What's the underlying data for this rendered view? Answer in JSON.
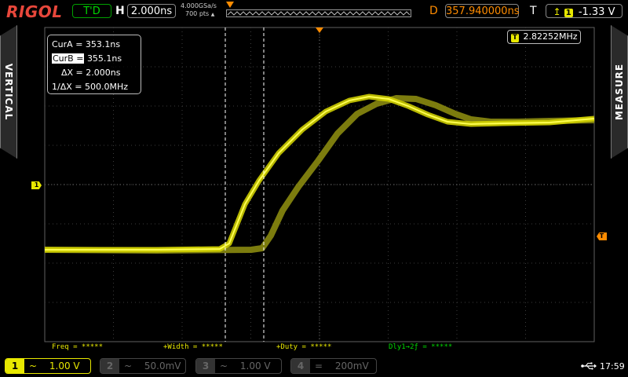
{
  "header": {
    "brand": "RIGOL",
    "run_status": "T'D",
    "timebase_label": "H",
    "timebase_value": "2.000ns",
    "sample_rate": "4.000GSa/s",
    "memory_depth": "700 pts",
    "delay_label": "D",
    "delay_value": "357.940000ns",
    "trigger_label": "T",
    "trigger_channel": "1",
    "trigger_level": "-1.33 V"
  },
  "side_tabs": {
    "left": "VERTICAL",
    "right": "MEASURE"
  },
  "cursors": {
    "cur_a_label": "CurA =",
    "cur_a_value": "353.1ns",
    "cur_b_label": "CurB =",
    "cur_b_value": "355.1ns",
    "delta_x_label": "ΔX =",
    "delta_x_value": "2.000ns",
    "inv_delta_x_label": "1/ΔX =",
    "inv_delta_x_value": "500.0MHz"
  },
  "frequency_counter": {
    "channel": "T",
    "value": "2.82252MHz"
  },
  "markers": {
    "channel_marker": "1",
    "trigger_marker": "T"
  },
  "measurements": {
    "freq": "Freq = *****",
    "width": "+Width = *****",
    "duty": "+Duty = *****",
    "delay": "Dly1→2ƒ = *****"
  },
  "channels": [
    {
      "num": "1",
      "coupling": "~",
      "scale": "1.00 V",
      "active": true
    },
    {
      "num": "2",
      "coupling": "~",
      "scale": "50.0mV",
      "active": false
    },
    {
      "num": "3",
      "coupling": "~",
      "scale": "1.00 V",
      "active": false
    },
    {
      "num": "4",
      "coupling": "=",
      "scale": "200mV",
      "active": false
    }
  ],
  "system": {
    "usb_icon": "usb-icon",
    "time": "17:59"
  },
  "colors": {
    "ch1": "#e8e800",
    "trigger": "#ff8c00",
    "brand": "#e8473b"
  }
}
